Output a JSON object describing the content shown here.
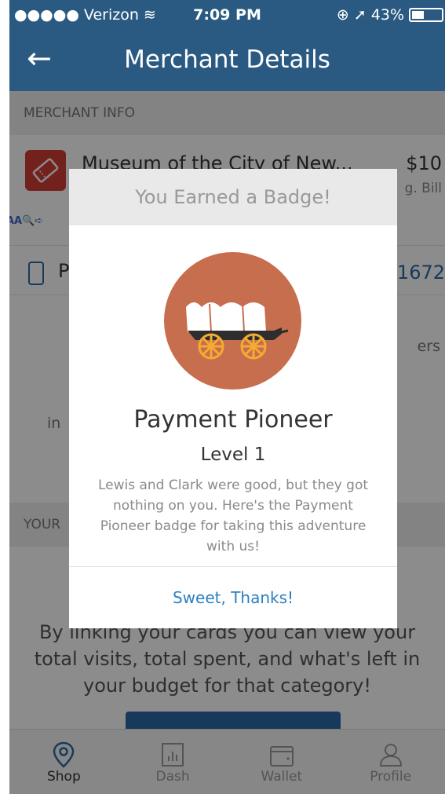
{
  "status_bar": {
    "carrier": "●●●●● Verizon ",
    "wifi_icon": "wifi-icon",
    "time": "7:09 PM",
    "battery_pct": "43%",
    "battery_level": 0.43
  },
  "navbar": {
    "back_icon": "back-arrow-icon",
    "back_glyph": "←",
    "title": "Merchant Details"
  },
  "merchant_info": {
    "section_label": "MERCHANT INFO",
    "name": "Museum of the City of New...",
    "amount": "$10",
    "sub_label": "g. Bill",
    "logo_icon": "ticket-icon",
    "tools_text": "AA🔍➪"
  },
  "phone_row": {
    "label": "P",
    "number": "1672"
  },
  "background_text": {
    "right_fragment": "ers",
    "left_fragment": "in"
  },
  "your_section": {
    "section_label": "YOUR"
  },
  "promo": {
    "line1": "By linking your cards you can view your",
    "line2": "total visits, total spent, and what's left in",
    "line3": "your budget for that category!"
  },
  "modal": {
    "header": "You Earned a Badge!",
    "badge_icon": "covered-wagon-icon",
    "badge_name": "Payment Pioneer",
    "badge_level": "Level 1",
    "description": "Lewis and Clark were good, but they got nothing on you. Here's the Payment Pioneer badge for taking this adventure with us!",
    "button_label": "Sweet, Thanks!"
  },
  "tabs": [
    {
      "label": "Shop",
      "icon": "map-pin-icon",
      "active": true
    },
    {
      "label": "Dash",
      "icon": "bar-chart-icon",
      "active": false
    },
    {
      "label": "Wallet",
      "icon": "wallet-icon",
      "active": false
    },
    {
      "label": "Profile",
      "icon": "user-icon",
      "active": false
    }
  ],
  "colors": {
    "nav_blue": "#2a5a82",
    "link_blue": "#2a7fc2",
    "badge_bg": "#c76e4f",
    "logo_red": "#d23c35"
  }
}
